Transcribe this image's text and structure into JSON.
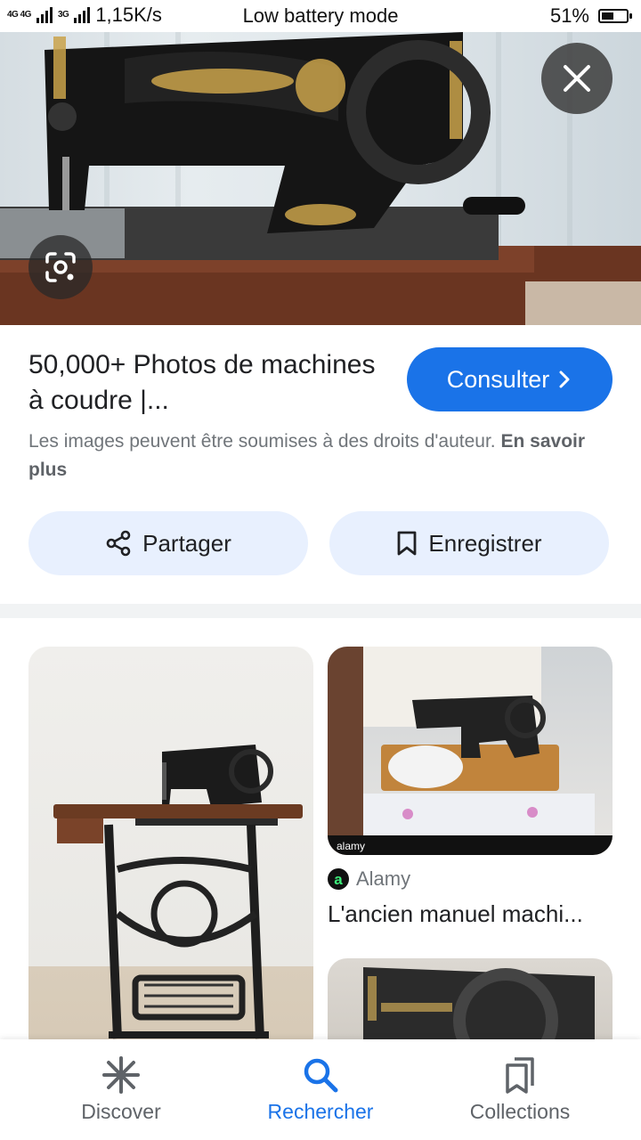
{
  "status_bar": {
    "network_left": "4G 4G",
    "network_right": "3G",
    "speed": "1,15K/s",
    "mode": "Low battery mode",
    "battery_percent": "51%",
    "battery_level": 0.51
  },
  "hero": {
    "close_icon": "close-icon",
    "lens_icon": "google-lens-icon"
  },
  "result": {
    "title": "50,000+ Photos de machines à coudre |...",
    "visit_label": "Consulter",
    "copyright_text": "Les images peuvent être soumises à des droits d'auteur.",
    "learn_more": "En savoir plus"
  },
  "actions": {
    "share_label": "Partager",
    "save_label": "Enregistrer"
  },
  "related": {
    "card_right": {
      "source": "Alamy",
      "source_icon_letter": "a",
      "title": "L'ancien manuel machi..."
    }
  },
  "bottom_nav": {
    "items": [
      {
        "label": "Discover",
        "icon": "asterisk-icon"
      },
      {
        "label": "Rechercher",
        "icon": "search-icon",
        "active": true
      },
      {
        "label": "Collections",
        "icon": "collections-icon"
      }
    ]
  },
  "colors": {
    "accent": "#1a73e8",
    "pill_bg": "#e8f0fe"
  }
}
